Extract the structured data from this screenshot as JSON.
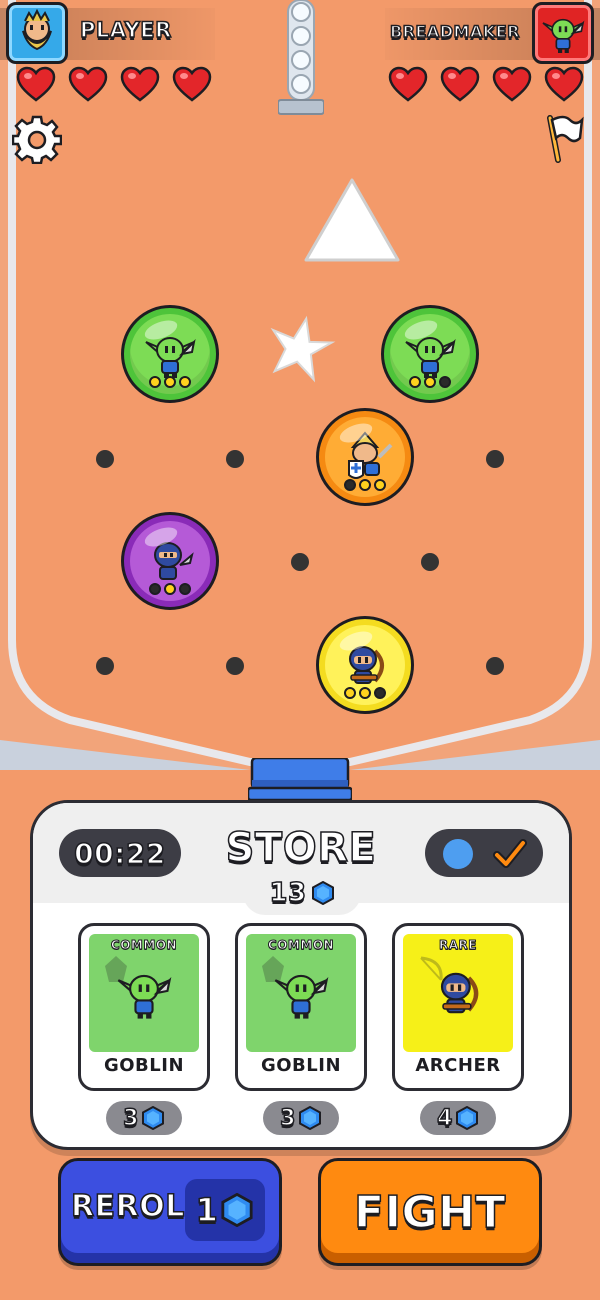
{
  "hud": {
    "player": {
      "name": "PLAYER",
      "hearts": 4,
      "avatar": "bearded-dwarf-avatar-icon",
      "color": "#35a9e9"
    },
    "opponent": {
      "name": "BREADMAKER",
      "hearts": 4,
      "avatar": "goblin-avatar-icon",
      "color": "#e02424"
    },
    "settings_icon": "gear-icon",
    "surrender_icon": "white-flag-icon"
  },
  "board": {
    "units": [
      {
        "id": "goblin-1",
        "type": "goblin",
        "rarity_color": "green",
        "stars": [
          1,
          1,
          1
        ]
      },
      {
        "id": "goblin-2",
        "type": "goblin",
        "rarity_color": "green",
        "stars": [
          1,
          1,
          0
        ]
      },
      {
        "id": "knight-1",
        "type": "knight",
        "rarity_color": "orange",
        "stars": [
          0,
          1,
          1
        ]
      },
      {
        "id": "ninja-1",
        "type": "ninja",
        "rarity_color": "purple",
        "stars": [
          0,
          1,
          0
        ]
      },
      {
        "id": "archer-1",
        "type": "archer",
        "rarity_color": "yellow",
        "stars": [
          1,
          1,
          0
        ]
      }
    ],
    "obstacles": [
      "triangle-bumper",
      "star-bumper"
    ]
  },
  "store": {
    "title": "STORE",
    "timer": "00:22",
    "gold": "13",
    "currency_icon": "blue-gem-icon",
    "cards": [
      {
        "rarity": "COMMON",
        "name": "GOBLIN",
        "price": "3"
      },
      {
        "rarity": "COMMON",
        "name": "GOBLIN",
        "price": "3"
      },
      {
        "rarity": "RARE",
        "name": "ARCHER",
        "price": "4"
      }
    ]
  },
  "buttons": {
    "reroll_label": "REROLL",
    "reroll_cost": "1",
    "fight_label": "FIGHT"
  },
  "colors": {
    "background": "#f39a6a",
    "reroll": "#3c4fe0",
    "fight": "#ff8a10",
    "common": "#7fd46c",
    "rare": "#f6f018",
    "gem": "#2f8bf0"
  }
}
